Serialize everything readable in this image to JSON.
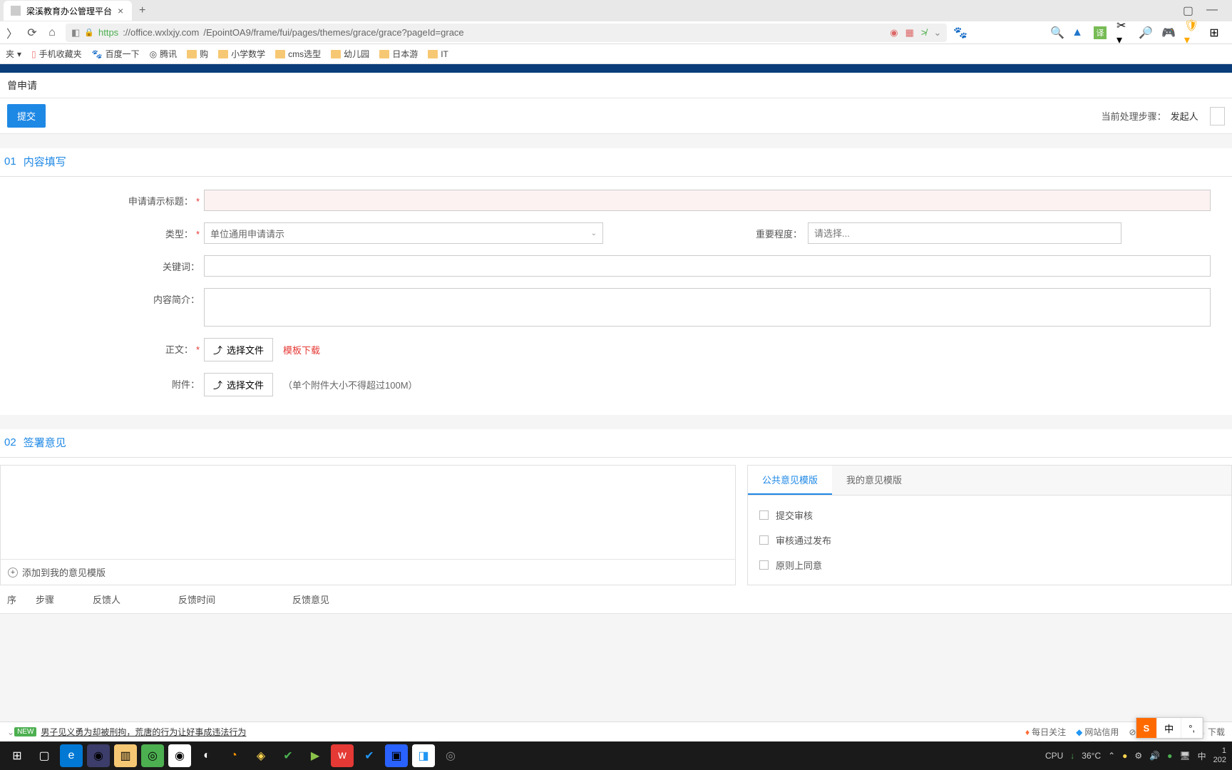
{
  "browser": {
    "tab_title": "梁溪教育办公管理平台",
    "url_protocol": "https",
    "url_host": "://office.wxlxjy.com",
    "url_path": "/EpointOA9/frame/fui/pages/themes/grace/grace?pageId=grace"
  },
  "bookmarks": [
    {
      "label": "夹",
      "icon": "menu"
    },
    {
      "label": "手机收藏夹",
      "icon": "phone"
    },
    {
      "label": "百度一下",
      "icon": "baidu"
    },
    {
      "label": "腾讯",
      "icon": "qq"
    },
    {
      "label": "购",
      "icon": "folder"
    },
    {
      "label": "小学数学",
      "icon": "folder"
    },
    {
      "label": "cms选型",
      "icon": "folder"
    },
    {
      "label": "幼儿园",
      "icon": "folder"
    },
    {
      "label": "日本游",
      "icon": "folder"
    },
    {
      "label": "IT",
      "icon": "folder"
    }
  ],
  "page": {
    "title": "曾申请",
    "submit": "提交",
    "step_label": "当前处理步骤：",
    "step_value": "发起人"
  },
  "section1": {
    "num": "01",
    "title": "内容填写",
    "fields": {
      "title_label": "申请请示标题：",
      "type_label": "类型：",
      "type_value": "单位通用申请请示",
      "priority_label": "重要程度：",
      "priority_placeholder": "请选择...",
      "keyword_label": "关键词：",
      "summary_label": "内容简介：",
      "body_label": "正文：",
      "file_btn": "选择文件",
      "template_link": "模板下载",
      "attach_label": "附件：",
      "attach_hint": "（单个附件大小不得超过100M）"
    }
  },
  "section2": {
    "num": "02",
    "title": "签署意见",
    "add_template": "添加到我的意见模版",
    "tabs": {
      "public": "公共意见模版",
      "mine": "我的意见模版"
    },
    "templates": [
      "提交审核",
      "审核通过发布",
      "原则上同意"
    ]
  },
  "feedback": {
    "col1": "序",
    "col2": "步骤",
    "col3": "反馈人",
    "col4": "反馈时间",
    "col5": "反馈意见"
  },
  "news": {
    "badge": "NEW",
    "text": "男子见义勇为却被刑拘，荒唐的行为让好事成违法行为",
    "hot": "每日关注",
    "trust": "网站信用",
    "download": "下载"
  },
  "taskbar": {
    "cpu": "CPU",
    "temp": "36°C",
    "ime": "中",
    "time1": "1",
    "time2": "202"
  },
  "ime": {
    "logo": "S",
    "lang": "中",
    "punct": "°,"
  }
}
